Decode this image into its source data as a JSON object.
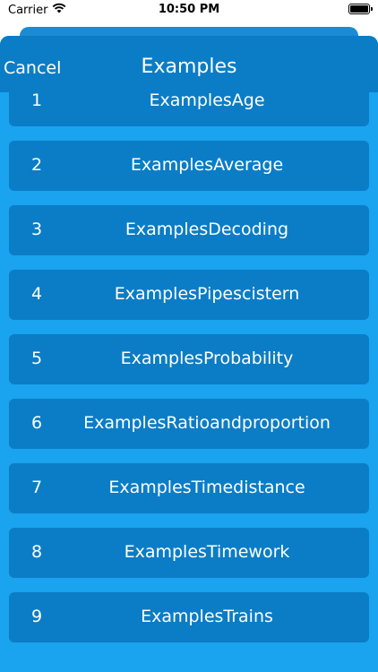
{
  "status_bar": {
    "carrier": "Carrier",
    "time": "10:50 PM"
  },
  "nav": {
    "cancel_label": "Cancel",
    "title": "Examples"
  },
  "items": [
    {
      "number": "1",
      "label": "ExamplesAge"
    },
    {
      "number": "2",
      "label": "ExamplesAverage"
    },
    {
      "number": "3",
      "label": "ExamplesDecoding"
    },
    {
      "number": "4",
      "label": "ExamplesPipescistern"
    },
    {
      "number": "5",
      "label": "ExamplesProbability"
    },
    {
      "number": "6",
      "label": "ExamplesRatioandproportion"
    },
    {
      "number": "7",
      "label": "ExamplesTimedistance"
    },
    {
      "number": "8",
      "label": "ExamplesTimework"
    },
    {
      "number": "9",
      "label": "ExamplesTrains"
    }
  ],
  "colors": {
    "nav_bar": "#0b7dc6",
    "sheet_background": "#1aa3ee",
    "row_background": "#0b7dc6",
    "text": "#ffffff"
  }
}
